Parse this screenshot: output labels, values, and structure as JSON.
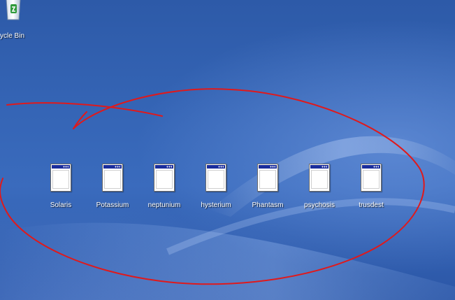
{
  "desktop": {
    "recycle_bin_label": "ycle Bin",
    "icons": [
      {
        "label": "Solaris",
        "icon": "application-window-icon"
      },
      {
        "label": "Potassium",
        "icon": "application-window-icon"
      },
      {
        "label": "neptunium",
        "icon": "application-window-icon"
      },
      {
        "label": "hysterium",
        "icon": "application-window-icon"
      },
      {
        "label": "Phantasm",
        "icon": "application-window-icon"
      },
      {
        "label": "psychosis",
        "icon": "application-window-icon"
      },
      {
        "label": "trusdest",
        "icon": "application-window-icon"
      }
    ]
  },
  "colors": {
    "wallpaper": "#3565b6",
    "icon_titlebar": "#1a2d9c",
    "annotation": "#e0191b"
  }
}
